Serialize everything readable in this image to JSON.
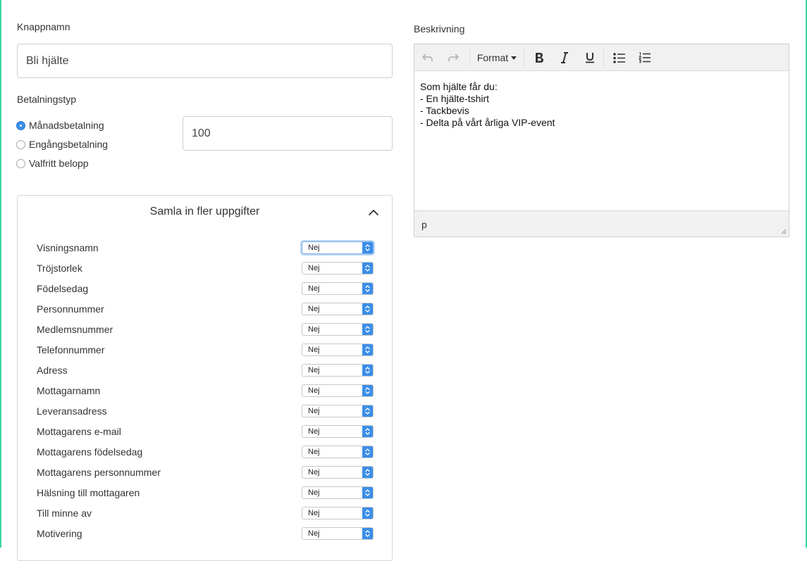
{
  "form": {
    "button_name": {
      "label": "Knappnamn",
      "value": "Bli hjälte"
    },
    "payment": {
      "label": "Betalningstyp",
      "options": [
        {
          "label": "Månadsbetalning",
          "checked": true
        },
        {
          "label": "Engångsbetalning",
          "checked": false
        },
        {
          "label": "Valfritt belopp",
          "checked": false
        }
      ],
      "amount": "100"
    },
    "collect": {
      "title": "Samla in fler uppgifter",
      "fields": [
        {
          "name": "Visningsnamn",
          "value": "Nej"
        },
        {
          "name": "Tröjstorlek",
          "value": "Nej"
        },
        {
          "name": "Födelsedag",
          "value": "Nej"
        },
        {
          "name": "Personnummer",
          "value": "Nej"
        },
        {
          "name": "Medlemsnummer",
          "value": "Nej"
        },
        {
          "name": "Telefonnummer",
          "value": "Nej"
        },
        {
          "name": "Adress",
          "value": "Nej"
        },
        {
          "name": "Mottagarnamn",
          "value": "Nej"
        },
        {
          "name": "Leveransadress",
          "value": "Nej"
        },
        {
          "name": "Mottagarens e-mail",
          "value": "Nej"
        },
        {
          "name": "Mottagarens födelsedag",
          "value": "Nej"
        },
        {
          "name": "Mottagarens personnummer",
          "value": "Nej"
        },
        {
          "name": "Hälsning till mottagaren",
          "value": "Nej"
        },
        {
          "name": "Till minne av",
          "value": "Nej"
        },
        {
          "name": "Motivering",
          "value": "Nej"
        }
      ]
    }
  },
  "description": {
    "label": "Beskrivning",
    "toolbar": {
      "format_label": "Format",
      "icons": [
        "undo-icon",
        "redo-icon",
        "bold-icon",
        "italic-icon",
        "underline-icon",
        "bullet-list-icon",
        "numbered-list-icon"
      ]
    },
    "content_lines": [
      "Som hjälte får du:",
      "- En hjälte-tshirt",
      "- Tackbevis",
      "- Delta på vårt årliga VIP-event"
    ],
    "status_path": "p"
  },
  "colors": {
    "accent": "#3b8ee8",
    "frame_border": "#3dd6a8",
    "toolbar_bg": "#f1f1f1"
  }
}
